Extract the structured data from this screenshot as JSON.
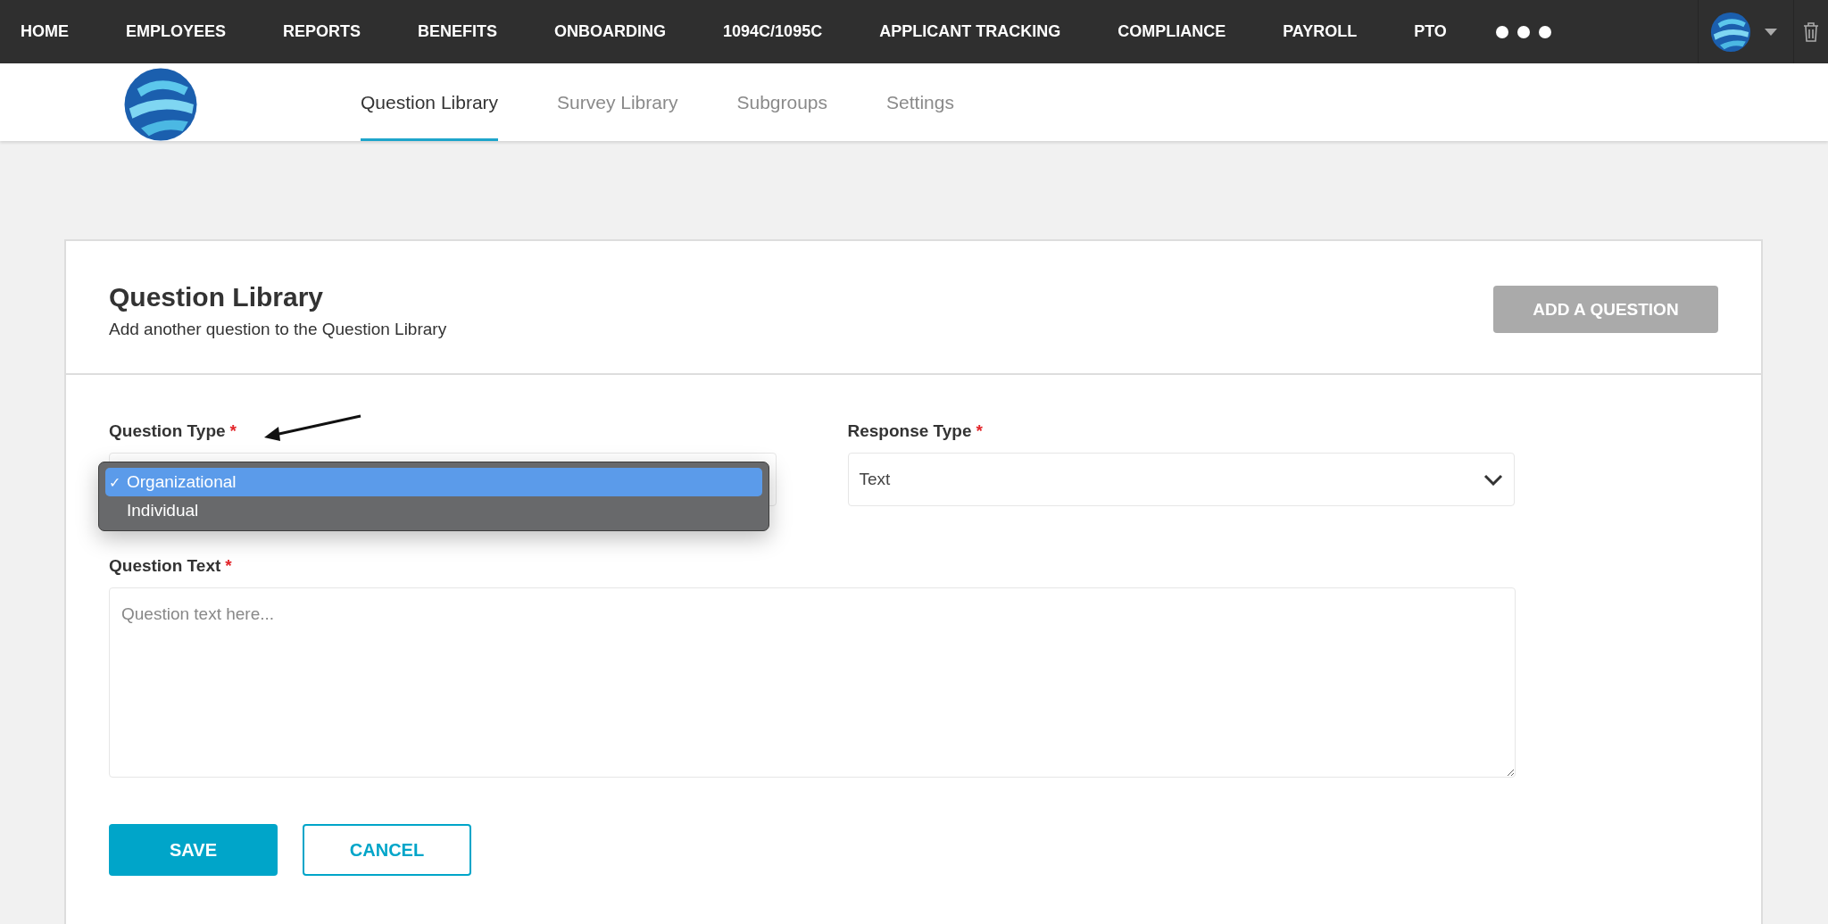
{
  "top_nav": {
    "items": [
      {
        "label": "HOME"
      },
      {
        "label": "EMPLOYEES"
      },
      {
        "label": "REPORTS"
      },
      {
        "label": "BENEFITS"
      },
      {
        "label": "ONBOARDING"
      },
      {
        "label": "1094C/1095C"
      },
      {
        "label": "APPLICANT TRACKING"
      },
      {
        "label": "COMPLIANCE"
      },
      {
        "label": "PAYROLL"
      },
      {
        "label": "PTO"
      }
    ]
  },
  "tabs": [
    {
      "label": "Question Library",
      "selected": true
    },
    {
      "label": "Survey Library",
      "selected": false
    },
    {
      "label": "Subgroups",
      "selected": false
    },
    {
      "label": "Settings",
      "selected": false
    }
  ],
  "card": {
    "title": "Question Library",
    "subtitle": "Add another question to the Question Library",
    "add_button": "ADD A QUESTION",
    "question_type": {
      "label": "Question Type",
      "required": "*",
      "options": [
        {
          "label": "Organizational",
          "selected": true,
          "check": "✓"
        },
        {
          "label": "Individual",
          "selected": false
        }
      ]
    },
    "response_type": {
      "label": "Response Type",
      "required": "*",
      "value": "Text"
    },
    "question_text": {
      "label": "Question Text",
      "required": "*",
      "placeholder": "Question text here..."
    },
    "buttons": {
      "save": "SAVE",
      "cancel": "CANCEL"
    }
  }
}
